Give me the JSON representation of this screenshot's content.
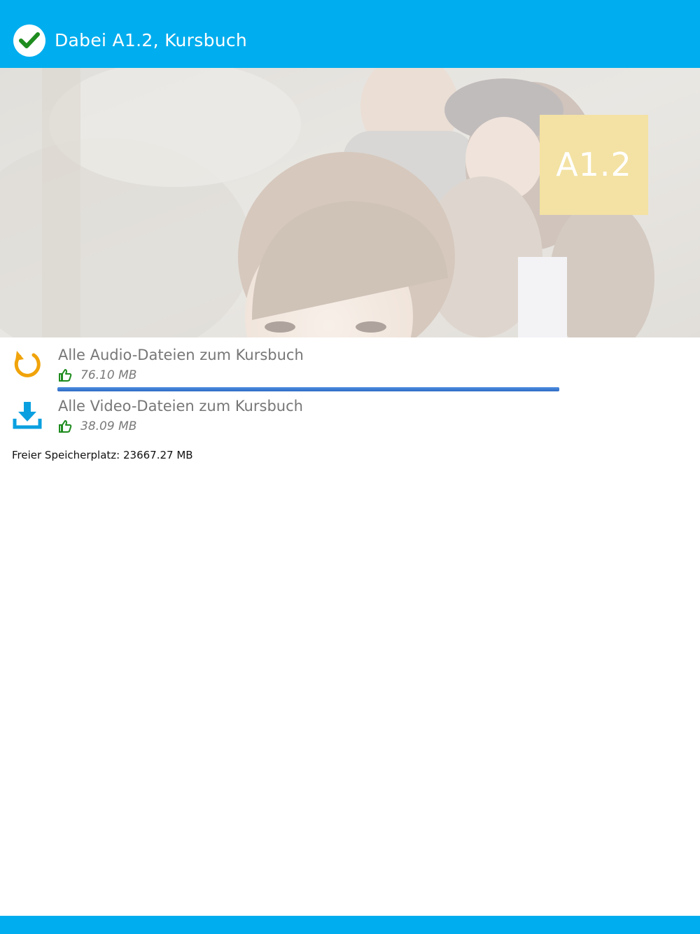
{
  "header": {
    "title": "Dabei A1.2, Kursbuch",
    "status_icon": "check-circle-icon"
  },
  "cover": {
    "level_badge": "A1.2",
    "badge_color": "#f3e2a3"
  },
  "downloads": [
    {
      "title": "Alle Audio-Dateien zum Kursbuch",
      "size": "76.10 MB",
      "status_icon": "refresh-icon",
      "status_color": "#f0a30a",
      "progress": 1.0
    },
    {
      "title": "Alle Video-Dateien zum Kursbuch",
      "size": "38.09 MB",
      "status_icon": "download-icon",
      "status_color": "#0aa0e0"
    }
  ],
  "storage": {
    "text": "Freier Speicherplatz: 23667.27 MB"
  },
  "colors": {
    "accent": "#00adee",
    "thumb_green": "#1f8c1f"
  }
}
